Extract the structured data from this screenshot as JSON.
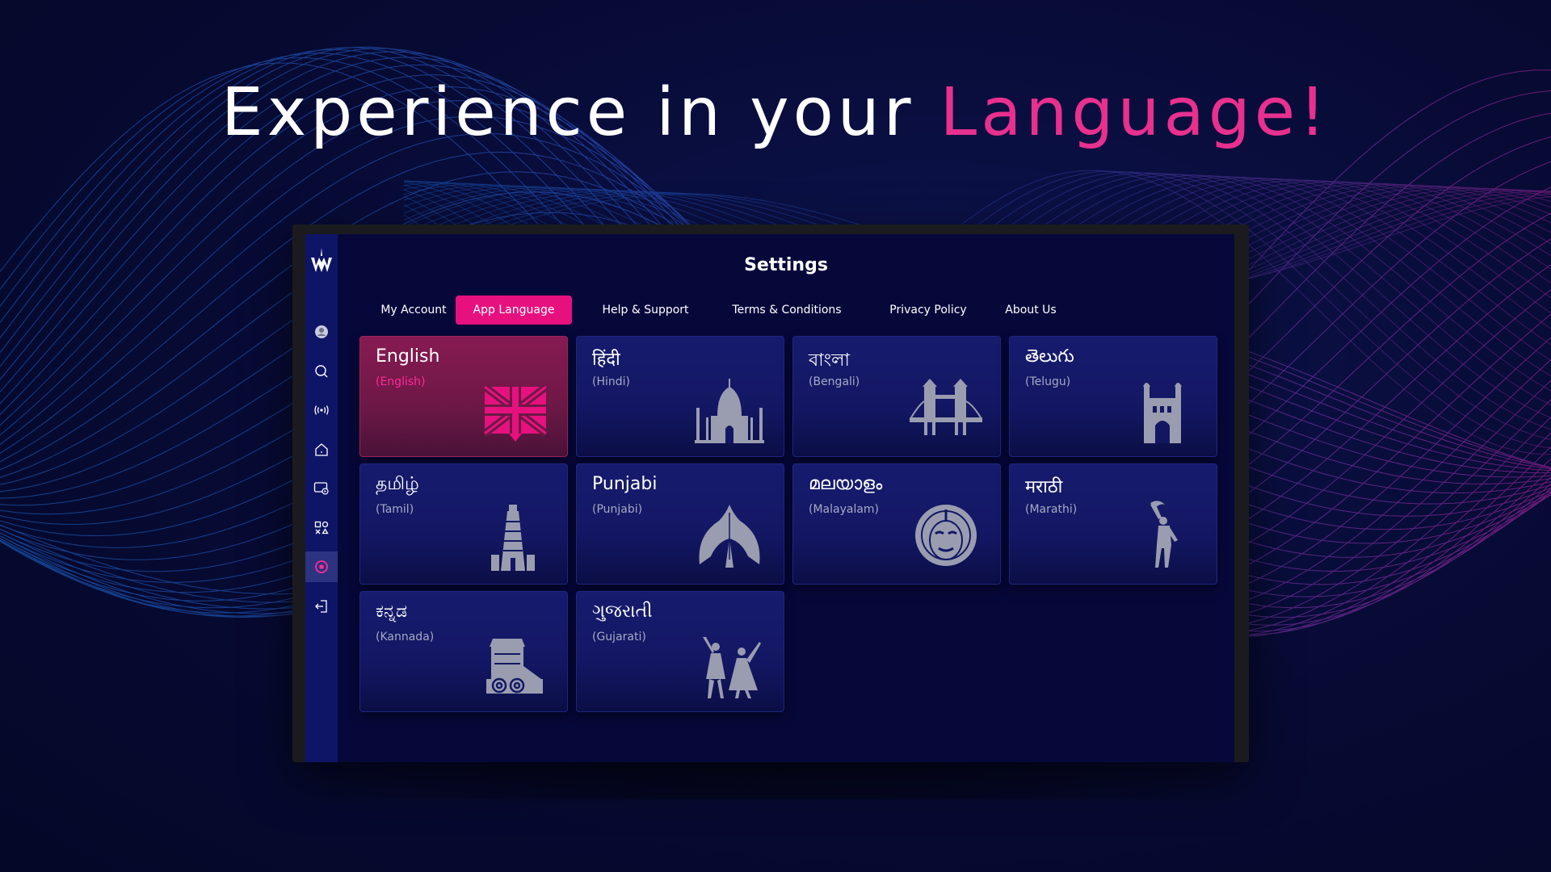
{
  "headline": {
    "prefix": "Experience in your ",
    "accent": "Language!"
  },
  "colors": {
    "accent": "#e6117e",
    "background": "#070a33",
    "sidebar": "#0f1566",
    "card": "#131763",
    "selected_card": "#6c1846"
  },
  "app": {
    "title": "Settings",
    "sidebar": {
      "logo": "app-logo",
      "items": [
        {
          "icon": "profile-avatar-icon"
        },
        {
          "icon": "search-icon"
        },
        {
          "icon": "live-broadcast-icon"
        },
        {
          "icon": "home-icon"
        },
        {
          "icon": "tv-shows-icon"
        },
        {
          "icon": "categories-icon"
        },
        {
          "icon": "settings-icon",
          "active": true
        },
        {
          "icon": "logout-icon"
        }
      ]
    },
    "tabs": [
      {
        "label": "My Account"
      },
      {
        "label": "App Language",
        "active": true
      },
      {
        "label": "Help & Support"
      },
      {
        "label": "Terms & Conditions"
      },
      {
        "label": "Privacy Policy"
      },
      {
        "label": "About Us"
      }
    ],
    "languages": [
      {
        "native": "English",
        "english": "(English)",
        "icon": "union-jack-icon",
        "selected": true
      },
      {
        "native": "हिंदी",
        "english": "(Hindi)",
        "icon": "taj-mahal-icon"
      },
      {
        "native": "বাংলা",
        "english": "(Bengali)",
        "icon": "bridge-icon"
      },
      {
        "native": "తెలుగు",
        "english": "(Telugu)",
        "icon": "charminar-icon"
      },
      {
        "native": "தமிழ்",
        "english": "(Tamil)",
        "icon": "temple-gopuram-icon"
      },
      {
        "native": "Punjabi",
        "english": "(Punjabi)",
        "icon": "golden-temple-dome-icon"
      },
      {
        "native": "മലയാളം",
        "english": "(Malayalam)",
        "icon": "kathakali-mask-icon"
      },
      {
        "native": "मराठी",
        "english": "(Marathi)",
        "icon": "dancer-icon"
      },
      {
        "native": "ಕನ್ನಡ",
        "english": "(Kannada)",
        "icon": "stone-chariot-icon"
      },
      {
        "native": "ગુજરાતી",
        "english": "(Gujarati)",
        "icon": "garba-dancers-icon"
      }
    ]
  }
}
